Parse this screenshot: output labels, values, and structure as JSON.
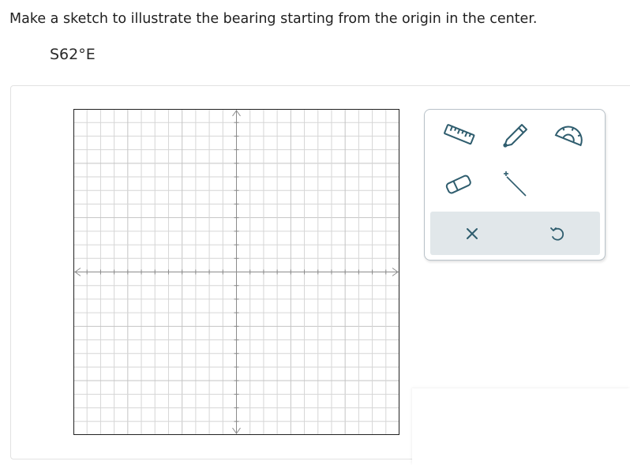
{
  "question": {
    "prompt": "Make a sketch to illustrate the bearing starting from the origin in the center.",
    "bearing": "S62°E"
  },
  "graph": {
    "grid_lines_per_side": 24,
    "grid_color": "#d6d6d6",
    "axis_color": "#8c8c8c",
    "border_color": "#222222"
  },
  "toolbox": {
    "tools": [
      "ruler-icon",
      "pencil-icon",
      "protractor-icon",
      "eraser-icon",
      "line-segment-icon"
    ],
    "actions": [
      "clear-icon",
      "undo-icon"
    ],
    "icon_color": "#2f5d6e",
    "action_bar_color": "#e1e7ea"
  }
}
